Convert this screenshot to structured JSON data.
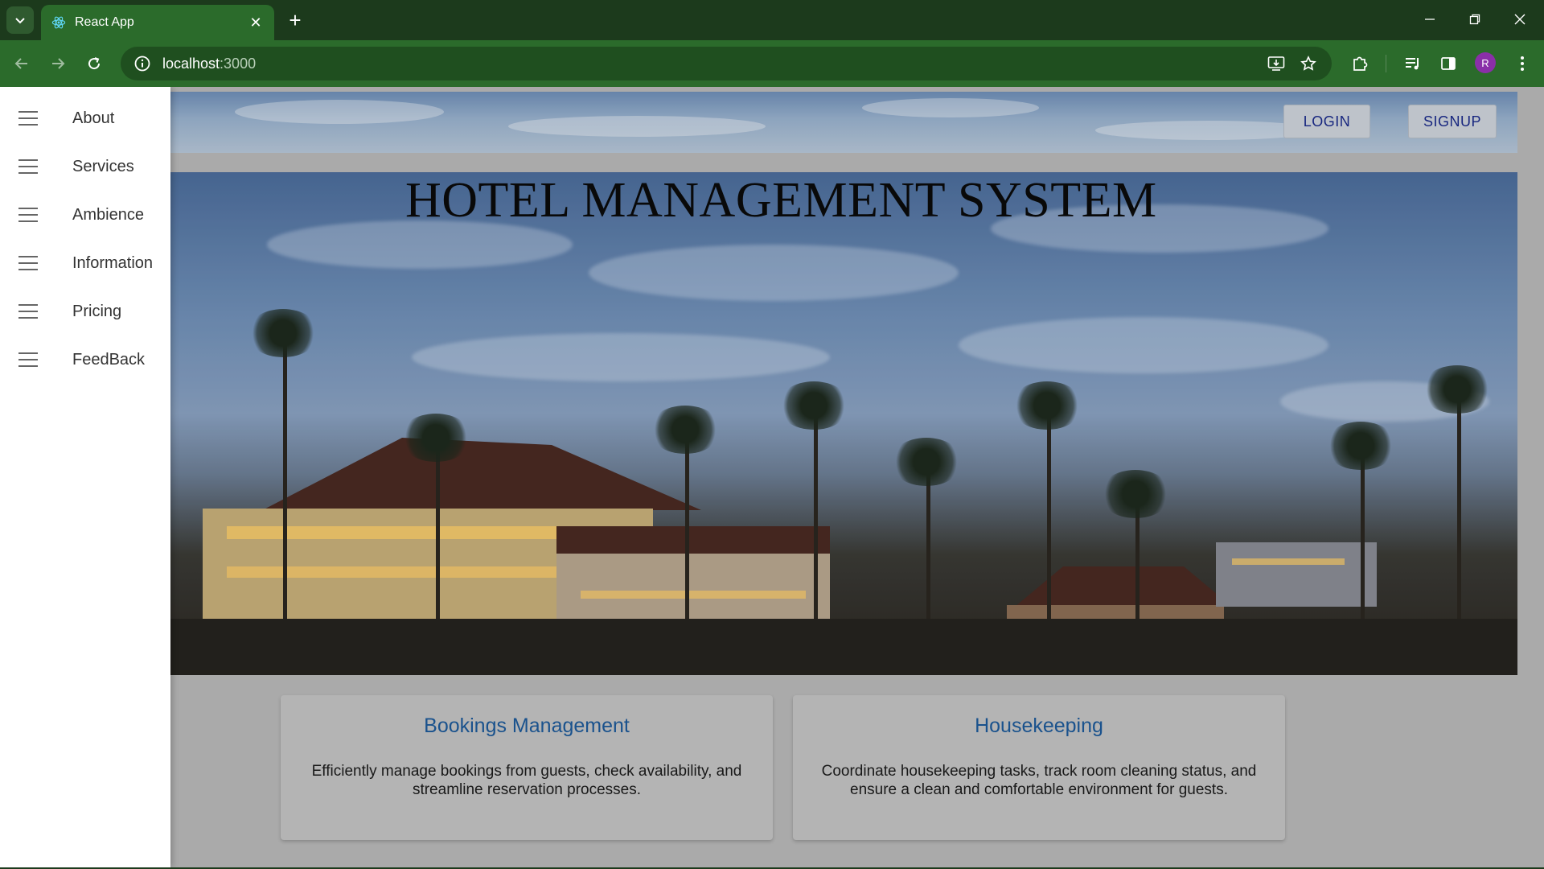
{
  "browser": {
    "tab_title": "React App",
    "url_host": "localhost",
    "url_port": ":3000",
    "profile_initial": "R"
  },
  "header": {
    "login_label": "LOGIN",
    "signup_label": "SIGNUP"
  },
  "hero": {
    "title": "HOTEL MANAGEMENT SYSTEM"
  },
  "drawer": {
    "items": [
      {
        "label": "About"
      },
      {
        "label": "Services"
      },
      {
        "label": "Ambience"
      },
      {
        "label": "Information"
      },
      {
        "label": "Pricing"
      },
      {
        "label": "FeedBack"
      }
    ]
  },
  "cards": [
    {
      "title": "Bookings Management",
      "description": "Efficiently manage bookings from guests, check availability, and streamline reservation processes."
    },
    {
      "title": "Housekeeping",
      "description": "Coordinate housekeeping tasks, track room cleaning status, and ensure a clean and comfortable environment for guests."
    }
  ],
  "colors": {
    "chrome_dark": "#1c3a1c",
    "chrome_toolbar": "#2b6b2b",
    "card_title": "#1d5a99",
    "auth_text": "#1a2a8a"
  }
}
